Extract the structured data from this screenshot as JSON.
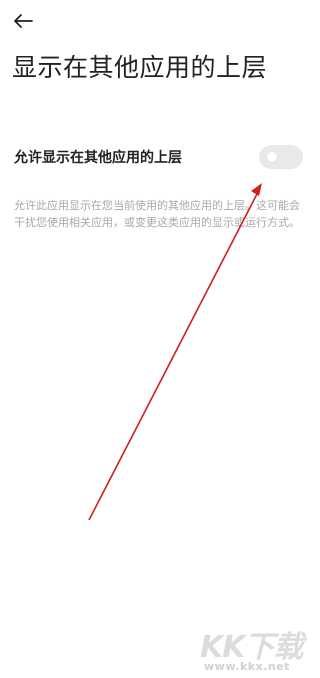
{
  "header": {
    "back_icon": "arrow-left-icon"
  },
  "page": {
    "title": "显示在其他应用的上层"
  },
  "setting": {
    "label": "允许显示在其他应用的上层",
    "toggle_state": "off",
    "description": "允许此应用显示在您当前使用的其他应用的上层。这可能会干扰您使用相关应用，或变更这类应用的显示或运行方式。"
  },
  "annotation": {
    "arrow_color": "#cc1f1f"
  },
  "watermark": {
    "logo": "KK下载",
    "url": "www.kkx.net"
  },
  "colors": {
    "background": "#ffffff",
    "title_text": "#222222",
    "description_text": "#a8a8a8",
    "toggle_track": "#e9e9e9"
  }
}
